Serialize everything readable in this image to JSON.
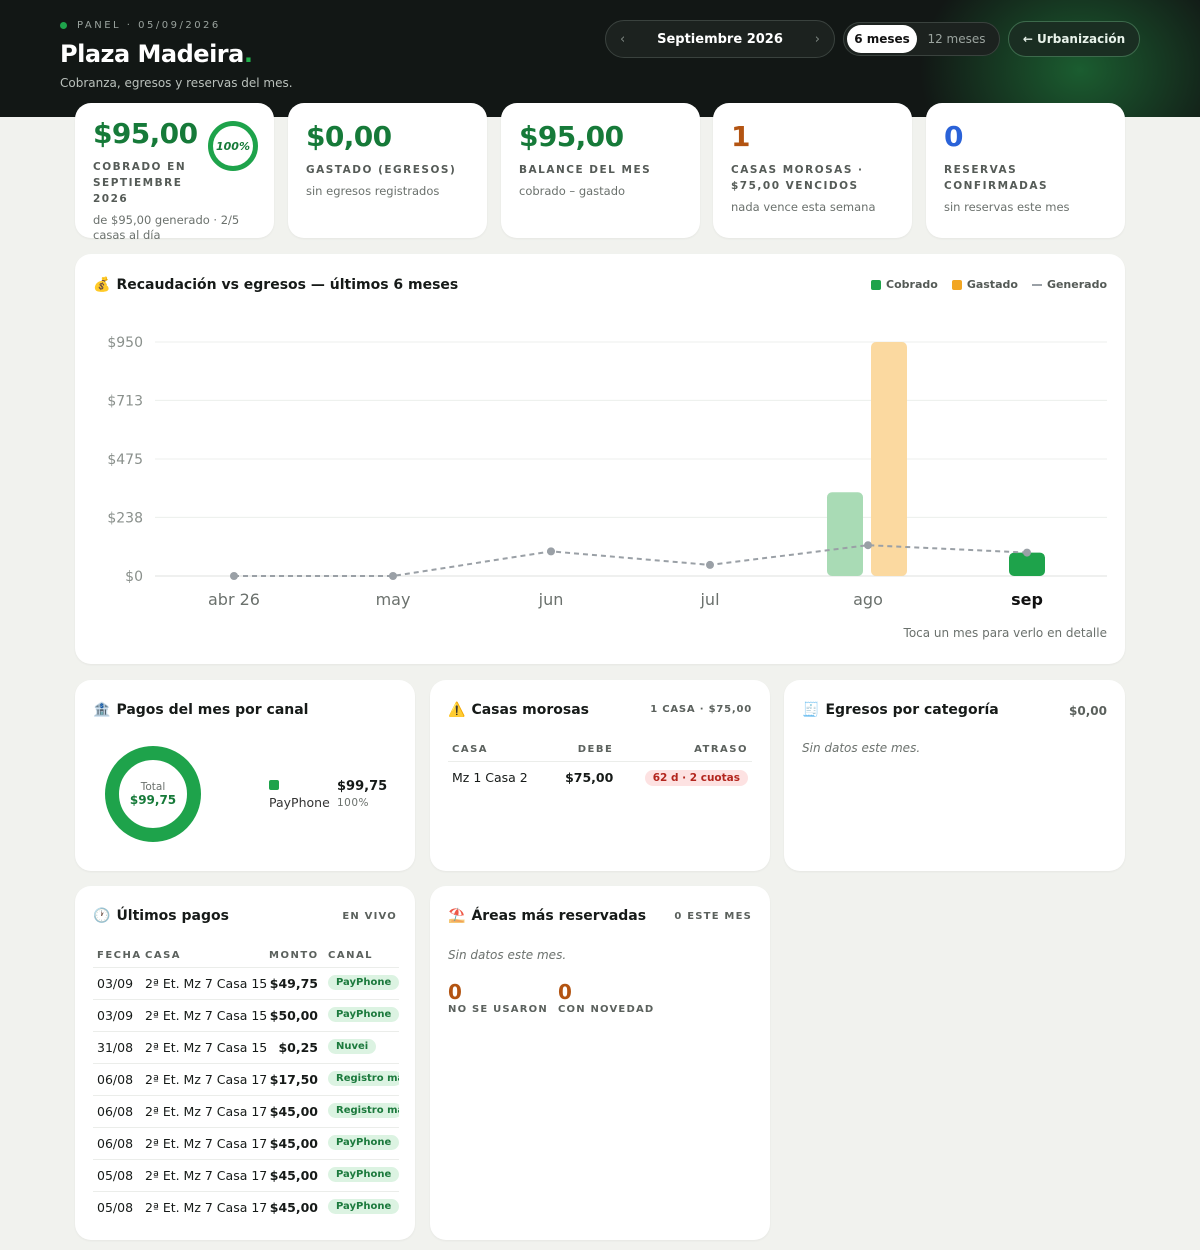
{
  "header": {
    "kicker": "PANEL · 05/09/2026",
    "title": "Plaza Madeira",
    "title_dot": ".",
    "subtitle": "Cobranza, egresos y reservas del mes.",
    "month_label": "Septiembre 2026",
    "prev_arrow": "‹",
    "next_arrow": "›",
    "range_6": "6 meses",
    "range_12": "12 meses",
    "back_label": "← Urbanización"
  },
  "kpis": [
    {
      "value": "$95,00",
      "label": "COBRADO EN SEPTIEMBRE 2026",
      "sub": "de $95,00 generado · 2/5 casas al día",
      "ring": "100%",
      "color": "#167a39"
    },
    {
      "value": "$0,00",
      "label": "GASTADO (EGRESOS)",
      "sub": "sin egresos registrados",
      "color": "#167a39"
    },
    {
      "value": "$95,00",
      "label": "BALANCE DEL MES",
      "sub": "cobrado – gastado",
      "color": "#167a39"
    },
    {
      "value": "1",
      "label": "CASAS MOROSAS · $75,00 VENCIDOS",
      "sub": "nada vence esta semana",
      "color": "#b35412"
    },
    {
      "value": "0",
      "label": "RESERVAS CONFIRMADAS",
      "sub": "sin reservas este mes",
      "color": "#2a62d8"
    }
  ],
  "chart": {
    "icon": "💰",
    "title": "Recaudación vs egresos — últimos 6 meses",
    "legend": {
      "cobrado": "Cobrado",
      "gastado": "Gastado",
      "generado": "Generado"
    },
    "hint": "Toca un mes para verlo en detalle"
  },
  "chart_data": {
    "type": "bar",
    "title": "Recaudación vs egresos — últimos 6 meses",
    "categories": [
      "abr 26",
      "may",
      "jun",
      "jul",
      "ago",
      "sep"
    ],
    "ylim": [
      0,
      950
    ],
    "ticks": [
      "$0",
      "$238",
      "$475",
      "$713",
      "$950"
    ],
    "tick_values": [
      0,
      238,
      475,
      713,
      950
    ],
    "series": [
      {
        "name": "Cobrado",
        "type": "bar",
        "values": [
          0,
          0,
          0,
          0,
          340,
          95
        ]
      },
      {
        "name": "Gastado",
        "type": "bar",
        "values": [
          0,
          0,
          0,
          0,
          950,
          0
        ]
      },
      {
        "name": "Generado",
        "type": "line",
        "values": [
          0,
          0,
          100,
          45,
          125,
          95
        ]
      }
    ],
    "selected": "sep",
    "colors": {
      "cobrado": "#a9dbb5",
      "cobrado_selected": "#1ea34b",
      "gastado": "#fbd9a0",
      "generado": "#9aa0a6"
    },
    "legend": "top-right",
    "grid": true
  },
  "canal": {
    "icon": "🏦",
    "title": "Pagos del mes por canal",
    "total_label": "Total",
    "total_value": "$99,75",
    "items": [
      {
        "name": "PayPhone",
        "amount": "$99,75",
        "pct": "100%",
        "color": "#1ea34b"
      }
    ]
  },
  "morosas": {
    "icon": "⚠️",
    "title": "Casas morosas",
    "summary": "1 CASA · $75,00",
    "headers": [
      "CASA",
      "DEBE",
      "ATRASO"
    ],
    "rows": [
      {
        "casa": "Mz 1 Casa 2",
        "debe": "$75,00",
        "atraso": "62 d · 2 cuotas"
      }
    ]
  },
  "egresos": {
    "icon": "🧾",
    "title": "Egresos por categoría",
    "total": "$0,00",
    "empty": "Sin datos este mes."
  },
  "ultimos": {
    "icon": "🕐",
    "title": "Últimos pagos",
    "badge": "EN VIVO",
    "headers": [
      "FECHA",
      "CASA",
      "MONTO",
      "CANAL"
    ],
    "rows": [
      {
        "fecha": "03/09",
        "casa": "2ª Et. Mz 7 Casa 15",
        "monto": "$49,75",
        "canal": "PayPhone"
      },
      {
        "fecha": "03/09",
        "casa": "2ª Et. Mz 7 Casa 15",
        "monto": "$50,00",
        "canal": "PayPhone"
      },
      {
        "fecha": "31/08",
        "casa": "2ª Et. Mz 7 Casa 15",
        "monto": "$0,25",
        "canal": "Nuvei"
      },
      {
        "fecha": "06/08",
        "casa": "2ª Et. Mz 7 Casa 17",
        "monto": "$17,50",
        "canal": "Registro ma"
      },
      {
        "fecha": "06/08",
        "casa": "2ª Et. Mz 7 Casa 17",
        "monto": "$45,00",
        "canal": "Registro ma"
      },
      {
        "fecha": "06/08",
        "casa": "2ª Et. Mz 7 Casa 17",
        "monto": "$45,00",
        "canal": "PayPhone"
      },
      {
        "fecha": "05/08",
        "casa": "2ª Et. Mz 7 Casa 17",
        "monto": "$45,00",
        "canal": "PayPhone"
      },
      {
        "fecha": "05/08",
        "casa": "2ª Et. Mz 7 Casa 17",
        "monto": "$45,00",
        "canal": "PayPhone"
      }
    ]
  },
  "areas": {
    "icon": "⛱️",
    "title": "Áreas más reservadas",
    "badge": "0 ESTE MES",
    "empty": "Sin datos este mes.",
    "stat1_value": "0",
    "stat1_label": "NO SE USARON",
    "stat2_value": "0",
    "stat2_label": "CON NOVEDAD"
  }
}
